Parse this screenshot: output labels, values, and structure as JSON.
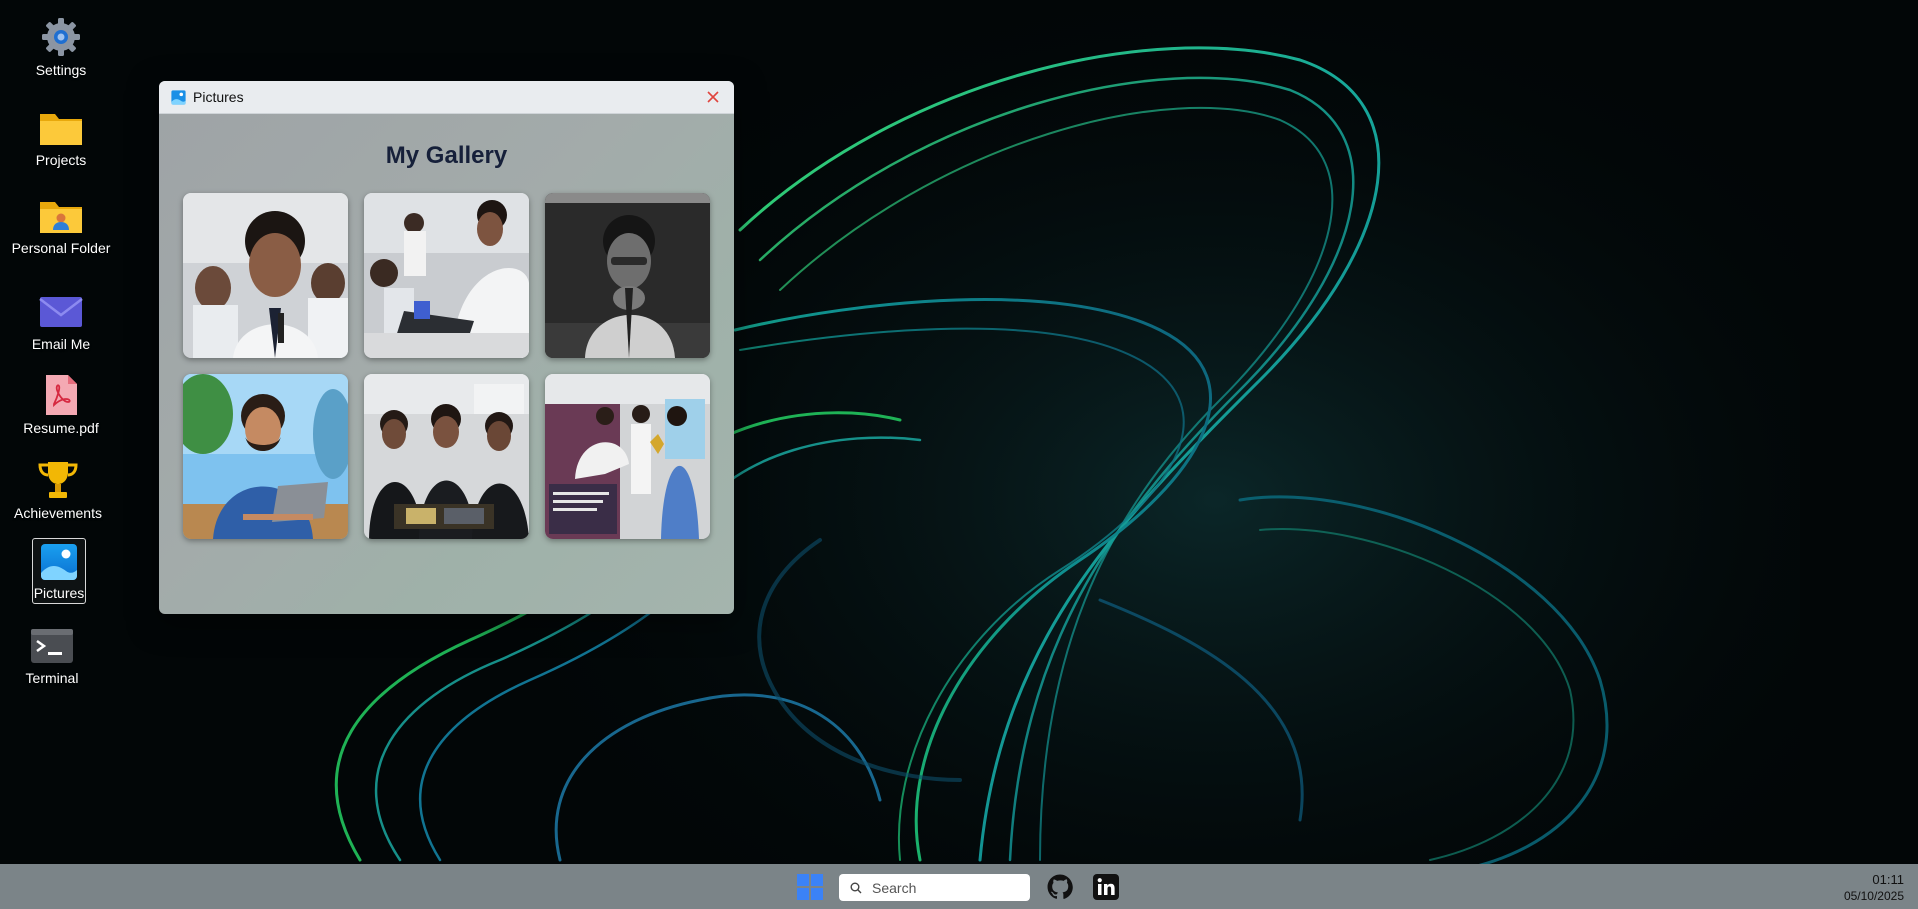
{
  "desktop": {
    "icons": [
      {
        "label": "Settings",
        "icon": "gear-icon"
      },
      {
        "label": "Projects",
        "icon": "folder-icon"
      },
      {
        "label": "Personal Folder",
        "icon": "user-folder-icon"
      },
      {
        "label": "Email Me",
        "icon": "envelope-icon"
      },
      {
        "label": "Resume.pdf",
        "icon": "pdf-icon"
      },
      {
        "label": "Achievements",
        "icon": "trophy-icon"
      },
      {
        "label": "Pictures",
        "icon": "pictures-icon",
        "selected": true
      },
      {
        "label": "Terminal",
        "icon": "terminal-icon"
      }
    ]
  },
  "window": {
    "title": "Pictures",
    "heading": "My Gallery",
    "photos": [
      {
        "name": "gallery-photo-1"
      },
      {
        "name": "gallery-photo-2"
      },
      {
        "name": "gallery-photo-3"
      },
      {
        "name": "gallery-photo-4"
      },
      {
        "name": "gallery-photo-5"
      },
      {
        "name": "gallery-photo-6"
      }
    ]
  },
  "taskbar": {
    "search_placeholder": "Search",
    "icons": [
      "windows-start-icon",
      "github-icon",
      "linkedin-icon"
    ],
    "time": "01:11",
    "date": "05/10/2025"
  },
  "colors": {
    "accent": "#3b82f6",
    "taskbar": "#7b8488",
    "heading": "#16203a",
    "close": "#e0443e"
  }
}
